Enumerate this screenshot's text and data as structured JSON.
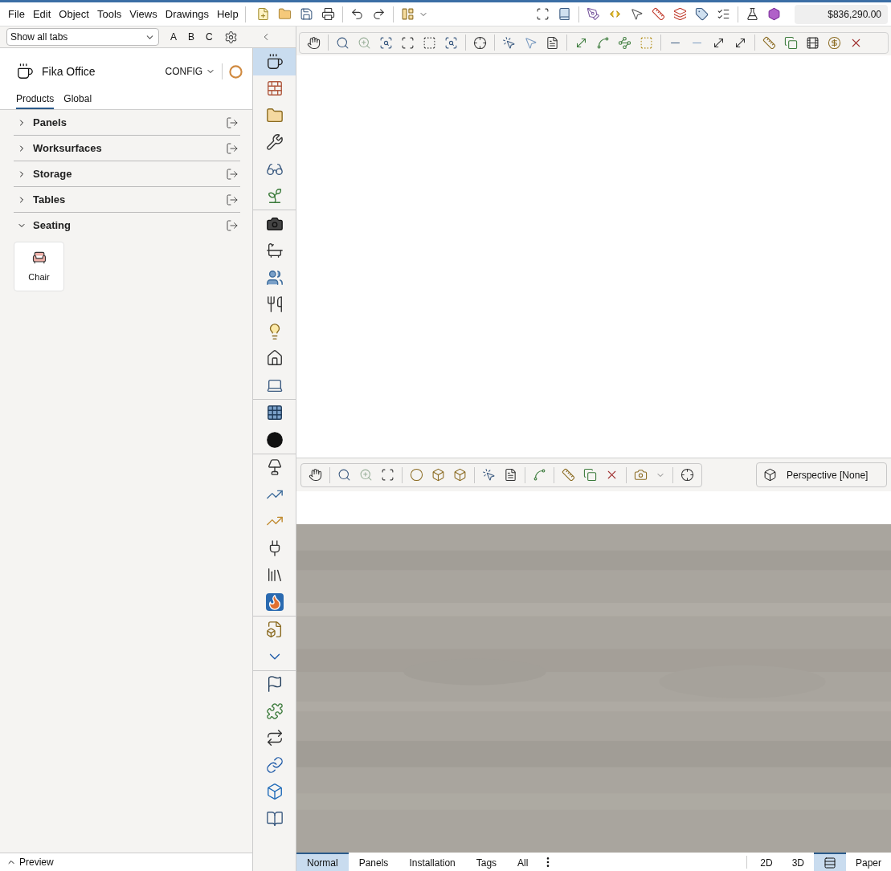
{
  "menu": [
    "File",
    "Edit",
    "Object",
    "Tools",
    "Views",
    "Drawings",
    "Help"
  ],
  "price": "$836,290.00",
  "filter": {
    "value": "Show all tabs",
    "letters": [
      "A",
      "B",
      "C"
    ]
  },
  "catalog": {
    "title": "Fika Office",
    "config": "CONFIG",
    "tabs": [
      {
        "label": "Products",
        "selected": true
      },
      {
        "label": "Global",
        "selected": false
      }
    ],
    "sections": [
      {
        "label": "Panels",
        "expanded": false
      },
      {
        "label": "Worksurfaces",
        "expanded": false
      },
      {
        "label": "Storage",
        "expanded": false
      },
      {
        "label": "Tables",
        "expanded": false
      },
      {
        "label": "Seating",
        "expanded": true,
        "items": [
          {
            "label": "Chair"
          }
        ]
      }
    ]
  },
  "preview": {
    "label": "Preview",
    "expanded": false
  },
  "tool_strip": [
    {
      "selected": true
    },
    {
      "selected": false
    },
    {
      "selected": false
    },
    {
      "selected": false
    },
    {
      "selected": false
    },
    {
      "selected": false
    },
    {
      "selected": false
    },
    {
      "selected": false
    },
    {
      "selected": false
    },
    {
      "selected": false
    },
    {
      "selected": false
    },
    {
      "selected": false
    },
    {
      "selected": false
    },
    {
      "selected": false
    },
    {
      "selected": false
    },
    {
      "selected": false
    },
    {
      "selected": false
    },
    {
      "selected": false
    },
    {
      "selected": false
    },
    {
      "selected": false
    },
    {
      "selected": false
    },
    {
      "selected": false
    },
    {
      "selected": false
    },
    {
      "selected": false
    },
    {
      "selected": false
    },
    {
      "selected": false
    },
    {
      "selected": false
    },
    {
      "selected": false
    },
    {
      "selected": false
    }
  ],
  "camera": {
    "label": "Perspective [None]"
  },
  "view_tabs": [
    {
      "label": "Normal",
      "selected": true
    },
    {
      "label": "Panels",
      "selected": false
    },
    {
      "label": "Installation",
      "selected": false
    },
    {
      "label": "Tags",
      "selected": false
    },
    {
      "label": "All",
      "selected": false
    }
  ],
  "view_modes": [
    {
      "kind": "text",
      "label": "2D",
      "selected": false
    },
    {
      "kind": "text",
      "label": "3D",
      "selected": false
    },
    {
      "kind": "icon",
      "selected": true
    },
    {
      "kind": "text",
      "label": "Paper",
      "selected": false
    }
  ]
}
